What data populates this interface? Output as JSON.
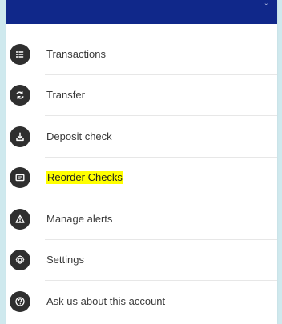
{
  "menu": {
    "items": [
      {
        "label": "Transactions",
        "icon": "transactions-icon"
      },
      {
        "label": "Transfer",
        "icon": "transfer-icon"
      },
      {
        "label": "Deposit check",
        "icon": "deposit-check-icon"
      },
      {
        "label": "Reorder Checks",
        "icon": "reorder-checks-icon",
        "highlighted": true
      },
      {
        "label": "Manage alerts",
        "icon": "alerts-icon"
      },
      {
        "label": "Settings",
        "icon": "settings-icon"
      },
      {
        "label": "Ask us about this account",
        "icon": "help-icon"
      }
    ]
  },
  "colors": {
    "header": "#10288a",
    "icon_background": "#2f2f2f",
    "highlight": "#ffff00",
    "page_background": "#cfe9ee"
  }
}
